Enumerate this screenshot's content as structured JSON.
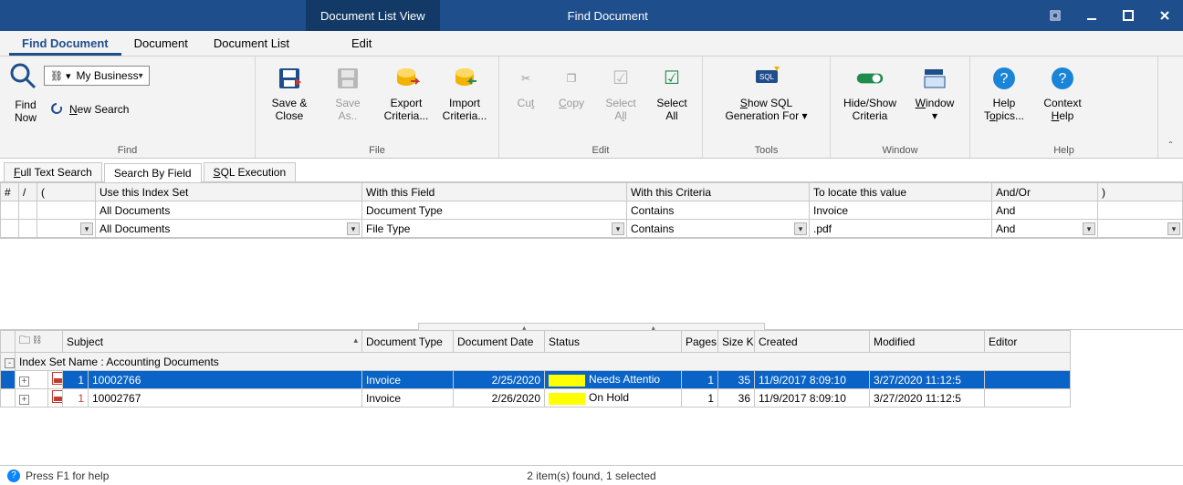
{
  "titlebar": {
    "section": "Document List View",
    "title": "Find Document"
  },
  "menubar": {
    "items": [
      "Find Document",
      "Document",
      "Document List",
      "Edit"
    ],
    "active": 0
  },
  "ribbon": {
    "find": {
      "group_label": "Find",
      "find_now": "Find\nNow",
      "scope_value": "My Business",
      "new_search": "New Search"
    },
    "file": {
      "group_label": "File",
      "save_close": "Save &\nClose",
      "save_as": "Save\nAs..",
      "export_criteria": "Export\nCriteria...",
      "import_criteria": "Import\nCriteria..."
    },
    "edit": {
      "group_label": "Edit",
      "cut": "Cut",
      "copy": "Copy",
      "select_all": "Select\nAll",
      "select_all2": "Select\nAll"
    },
    "tools": {
      "group_label": "Tools",
      "show_sql": "Show SQL\nGeneration For"
    },
    "window": {
      "group_label": "Window",
      "hide_show": "Hide/Show\nCriteria",
      "window": "Window"
    },
    "help": {
      "group_label": "Help",
      "help_topics": "Help\nTopics...",
      "context_help": "Context\nHelp"
    }
  },
  "search_tabs": {
    "items": [
      "Full Text Search",
      "Search By Field",
      "SQL Execution"
    ],
    "active": 1
  },
  "criteria": {
    "headers": {
      "num": "#",
      "slash": "/",
      "paren_open": "(",
      "index_set": "Use this Index Set",
      "field": "With this Field",
      "criteria": "With this Criteria",
      "value": "To locate this value",
      "andor": "And/Or",
      "paren_close": ")"
    },
    "rows": [
      {
        "index_set": "All Documents",
        "field": "Document Type",
        "criteria": "Contains",
        "value": "Invoice",
        "andor": "And"
      },
      {
        "index_set": "All Documents",
        "field": "File Type",
        "criteria": "Contains",
        "value": ".pdf",
        "andor": "And"
      }
    ]
  },
  "results": {
    "columns": {
      "subject": "Subject",
      "doctype": "Document Type",
      "docdate": "Document Date",
      "status": "Status",
      "pages": "Pages",
      "sizek": "Size K",
      "created": "Created",
      "modified": "Modified",
      "editor": "Editor"
    },
    "group_label": "Index Set Name : Accounting Documents",
    "rows": [
      {
        "idx": "1",
        "subject": "10002766",
        "doctype": "Invoice",
        "docdate": "2/25/2020",
        "status": "Needs Attentio",
        "pages": "1",
        "sizek": "35",
        "created": "11/9/2017 8:09:10",
        "modified": "3/27/2020 11:12:5",
        "editor": "",
        "selected": true
      },
      {
        "idx": "1",
        "subject": "10002767",
        "doctype": "Invoice",
        "docdate": "2/26/2020",
        "status": "On Hold",
        "pages": "1",
        "sizek": "36",
        "created": "11/9/2017 8:09:10",
        "modified": "3/27/2020 11:12:5",
        "editor": "",
        "selected": false
      }
    ]
  },
  "statusbar": {
    "help": "Press F1 for help",
    "summary": "2 item(s) found, 1 selected"
  }
}
